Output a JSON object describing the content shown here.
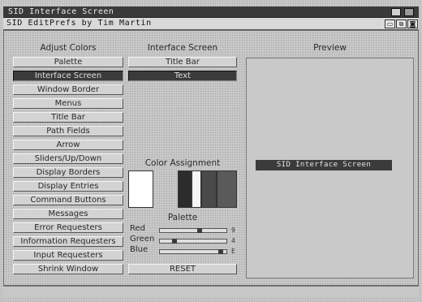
{
  "window": {
    "title": "SID Interface Screen",
    "menubar_text": "SID EditPrefs by Tim Martin"
  },
  "columns": {
    "adjust_header": "Adjust Colors",
    "interface_header": "Interface Screen",
    "preview_header": "Preview"
  },
  "adjust_colors": [
    {
      "label": "Palette",
      "selected": false
    },
    {
      "label": "Interface Screen",
      "selected": true
    },
    {
      "label": "Window Border",
      "selected": false
    },
    {
      "label": "Menus",
      "selected": false
    },
    {
      "label": "Title Bar",
      "selected": false
    },
    {
      "label": "Path Fields",
      "selected": false
    },
    {
      "label": "Arrow",
      "selected": false
    },
    {
      "label": "Sliders/Up/Down",
      "selected": false
    },
    {
      "label": "Display Borders",
      "selected": false
    },
    {
      "label": "Display Entries",
      "selected": false
    },
    {
      "label": "Command Buttons",
      "selected": false
    },
    {
      "label": "Messages",
      "selected": false
    },
    {
      "label": "Error Requesters",
      "selected": false
    },
    {
      "label": "Information Requesters",
      "selected": false
    },
    {
      "label": "Input Requesters",
      "selected": false
    },
    {
      "label": "Shrink Window",
      "selected": false
    }
  ],
  "interface_items": [
    {
      "label": "Title Bar",
      "selected": false
    },
    {
      "label": "Text",
      "selected": true
    }
  ],
  "color_assignment": {
    "label": "Color Assignment"
  },
  "palette": {
    "label": "Palette",
    "sliders": [
      {
        "name": "Red",
        "value": "9",
        "level": 0.6
      },
      {
        "name": "Green",
        "value": "4",
        "level": 0.2
      },
      {
        "name": "Blue",
        "value": "E",
        "level": 0.95
      }
    ],
    "reset_label": "RESET"
  },
  "preview": {
    "bar_text": "SID Interface Screen"
  }
}
